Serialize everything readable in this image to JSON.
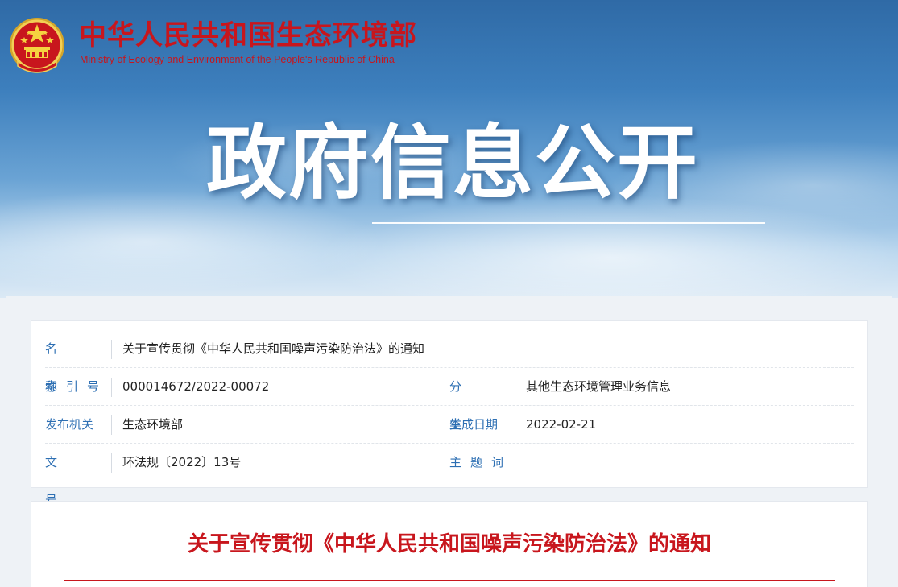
{
  "header": {
    "brand_cn": "中华人民共和国生态环境部",
    "brand_en": "Ministry of Ecology and Environment of the People's Republic of China",
    "hero_title": "政府信息公开"
  },
  "colors": {
    "brand_red": "#c8161d",
    "label_blue": "#2d6fb3"
  },
  "meta": {
    "name_label": "名　称",
    "name_value": "关于宣传贯彻《中华人民共和国噪声污染防治法》的通知",
    "index_label": "索引号",
    "index_value": "000014672/2022-00072",
    "category_label": "分　类",
    "category_value": "其他生态环境管理业务信息",
    "issuer_label": "发布机关",
    "issuer_value": "生态环境部",
    "date_label": "生成日期",
    "date_value": "2022-02-21",
    "docno_label": "文　号",
    "docno_value": "环法规〔2022〕13号",
    "subject_label": "主题词",
    "subject_value": ""
  },
  "document": {
    "title": "关于宣传贯彻《中华人民共和国噪声污染防治法》的通知"
  }
}
